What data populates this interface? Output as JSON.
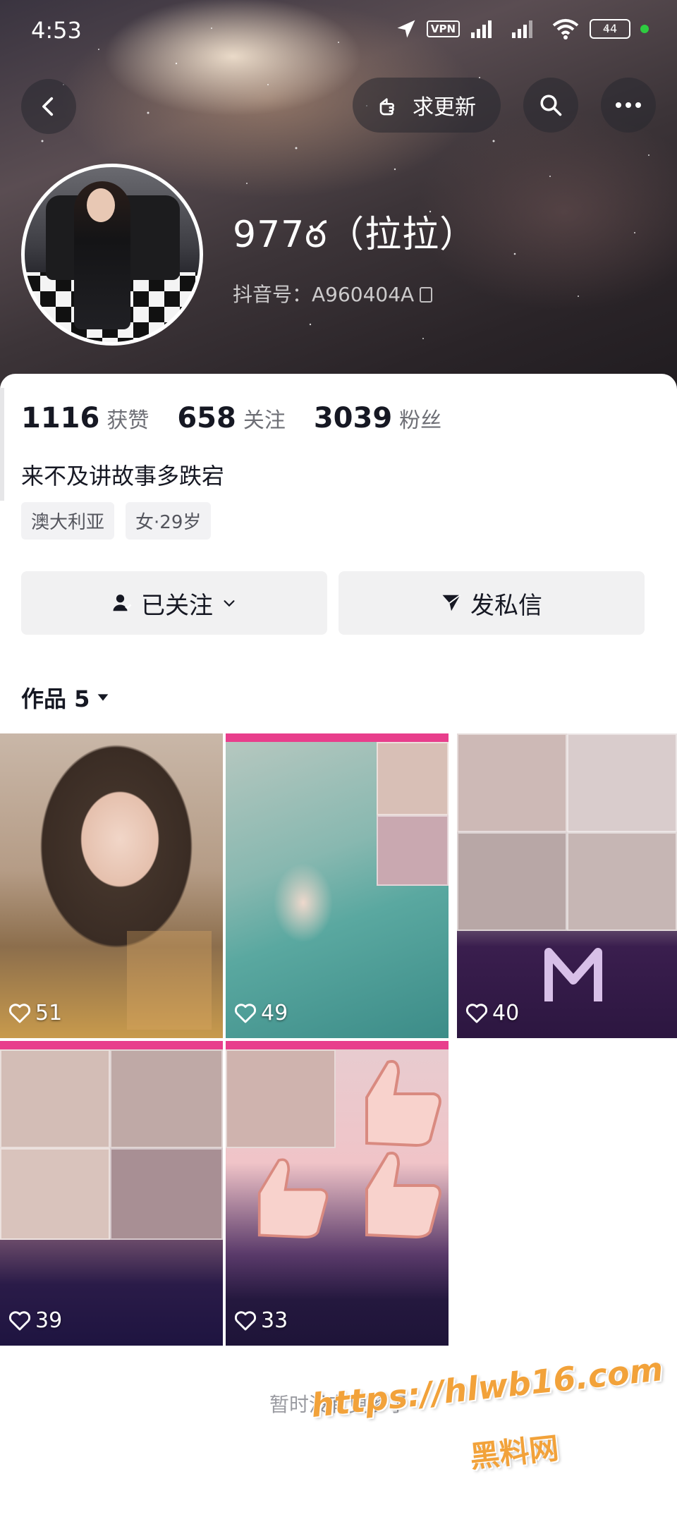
{
  "status_bar": {
    "time": "4:53",
    "vpn": "VPN",
    "battery": "44"
  },
  "header": {
    "update_label": "求更新",
    "nickname": "977ఠ（拉拉）",
    "douyin_id": "抖音号：A960404A"
  },
  "stats": [
    {
      "value": "1116",
      "label": "获赞"
    },
    {
      "value": "658",
      "label": "关注"
    },
    {
      "value": "3039",
      "label": "粉丝"
    }
  ],
  "bio": "来不及讲故事多跌宕",
  "tags": [
    "澳大利亚",
    "女·29岁"
  ],
  "actions": {
    "follow_label": "已关注",
    "message_label": "发私信"
  },
  "works": {
    "tab_label": "作品 5",
    "items": [
      {
        "likes": "51"
      },
      {
        "likes": "49"
      },
      {
        "likes": "40"
      },
      {
        "likes": "39"
      },
      {
        "likes": "33"
      }
    ]
  },
  "footer": {
    "no_more": "暂时没有更多了",
    "watermark_url": "https://hlwb16.com",
    "watermark_name": "黑料网"
  },
  "colors": {
    "accent_pink": "#e83e8c",
    "watermark": "#f2a23a"
  },
  "icons": {
    "back": "back-arrow-icon",
    "update": "hand-point-icon",
    "search": "search-icon",
    "more": "more-dots-icon",
    "follow": "user-icon",
    "message": "paper-plane-icon",
    "likes": "heart-icon",
    "dropdown": "caret-down-icon"
  }
}
